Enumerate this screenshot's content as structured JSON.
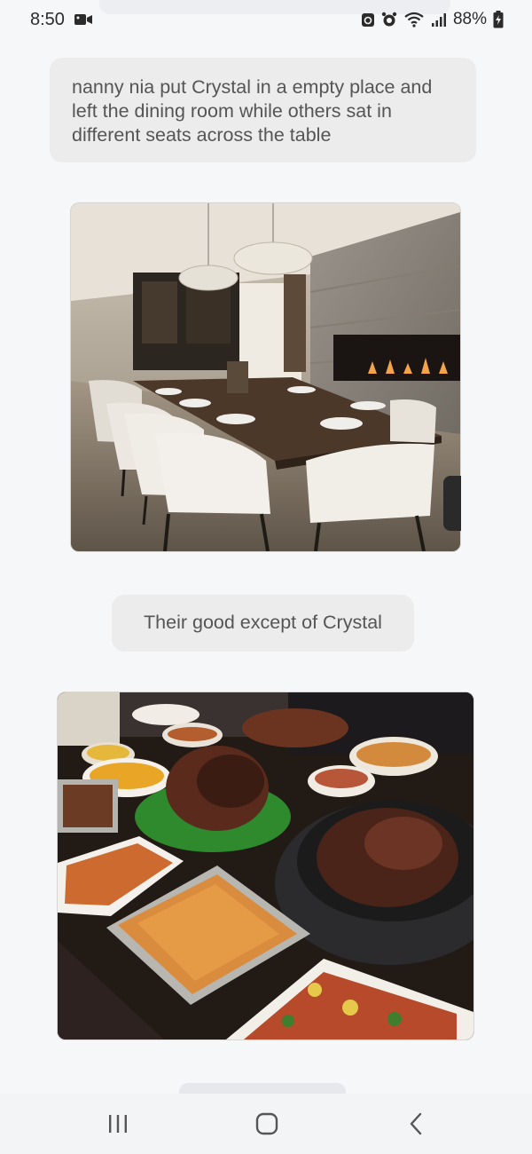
{
  "status_bar": {
    "time": "8:50",
    "battery": "88%",
    "icons": [
      "video-camera-icon",
      "recycle-icon",
      "alarm-icon",
      "wifi-icon",
      "signal-icon",
      "battery-charging-icon"
    ]
  },
  "messages": [
    {
      "type": "text",
      "text": "nanny nia put Crystal in a empty place and left the dining room while others sat in different seats across the table"
    },
    {
      "type": "image",
      "icon": "dining-room-photo"
    },
    {
      "type": "text",
      "text": "Their good except of Crystal"
    },
    {
      "type": "image",
      "icon": "food-spread-photo"
    }
  ],
  "nav_bar": {
    "icons": [
      "recents-icon",
      "home-icon",
      "back-icon"
    ]
  },
  "colors": {
    "background": "#f6f7f9",
    "bubble": "#ececec",
    "text": "#555555"
  }
}
